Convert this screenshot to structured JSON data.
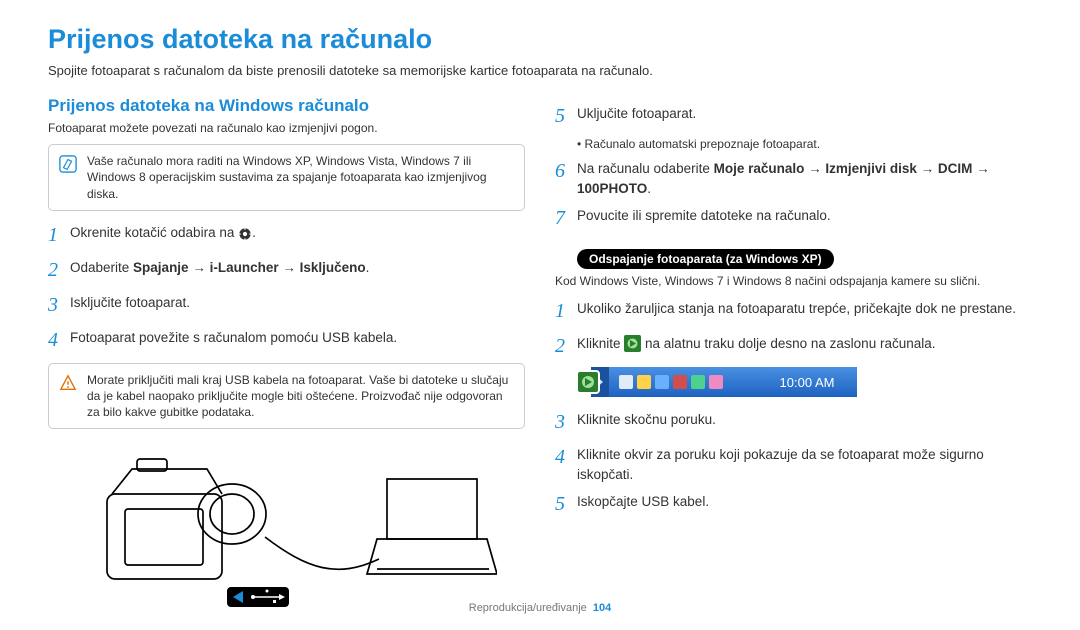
{
  "title": "Prijenos datoteka na računalo",
  "intro": "Spojite fotoaparat s računalom da biste prenosili datoteke sa memorijske kartice fotoaparata na računalo.",
  "left": {
    "section_title": "Prijenos datoteka na Windows računalo",
    "section_sub": "Fotoaparat možete povezati na računalo kao izmjenjivi pogon.",
    "note1": "Vaše računalo mora raditi na Windows XP, Windows Vista, Windows 7 ili Windows 8 operacijskim sustavima za spajanje fotoaparata kao izmjenjivog diska.",
    "step1_a": "Okrenite kotačić odabira na ",
    "step2_a": "Odaberite ",
    "step2_b": "Spajanje → i-Launcher → Isključeno",
    "step3": "Isključite fotoaparat.",
    "step4": "Fotoaparat povežite s računalom pomoću USB kabela.",
    "warn": "Morate priključiti mali kraj USB kabela na fotoaparat. Vaše bi datoteke u slučaju da je kabel naopako priključite mogle biti oštećene. Proizvođač nije odgovoran za bilo kakve gubitke podataka."
  },
  "right": {
    "step5": "Uključite fotoaparat.",
    "step5_sub": "Računalo automatski prepoznaje fotoaparat.",
    "step6_a": "Na računalu odaberite ",
    "step6_b": "Moje računalo → Izmjenjivi disk → DCIM → 100PHOTO",
    "step7": "Povucite ili spremite datoteke na računalo.",
    "badge": "Odspajanje fotoaparata (za Windows XP)",
    "badge_sub": "Kod Windows Viste, Windows 7 i Windows 8 načini odspajanja kamere su slični.",
    "b_step1": "Ukoliko žaruljica stanja na fotoaparatu trepće, pričekajte dok ne prestane.",
    "b_step2_a": "Kliknite ",
    "b_step2_b": " na alatnu traku dolje desno na zaslonu računala.",
    "taskbar_time": "10:00 AM",
    "b_step3": "Kliknite skočnu poruku.",
    "b_step4": "Kliknite okvir za poruku koji pokazuje da se fotoaparat može sigurno iskopčati.",
    "b_step5": "Iskopčajte USB kabel."
  },
  "footer": {
    "section": "Reprodukcija/uređivanje",
    "page": "104"
  }
}
